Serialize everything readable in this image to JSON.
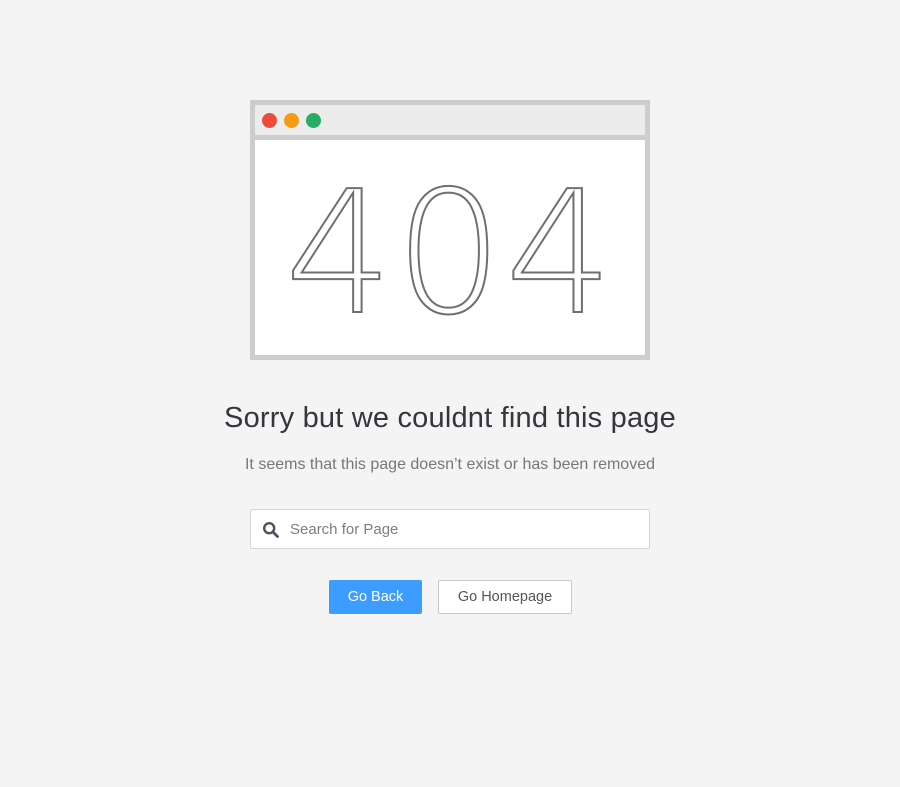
{
  "colors": {
    "background": "#f4f4f4",
    "window_close": "#ee4b3b",
    "window_minimize": "#f39c12",
    "window_maximize": "#27ae60",
    "primary_button": "#3d9cff"
  },
  "illustration": {
    "error_code": "404",
    "dots": [
      "close",
      "minimize",
      "maximize"
    ]
  },
  "message": {
    "title": "Sorry but we couldnt find this page",
    "subtitle": "It seems that this page doesn’t exist or has been removed"
  },
  "search": {
    "icon": "search-icon",
    "placeholder": "Search for Page",
    "value": ""
  },
  "actions": {
    "back_label": "Go Back",
    "home_label": "Go Homepage"
  }
}
